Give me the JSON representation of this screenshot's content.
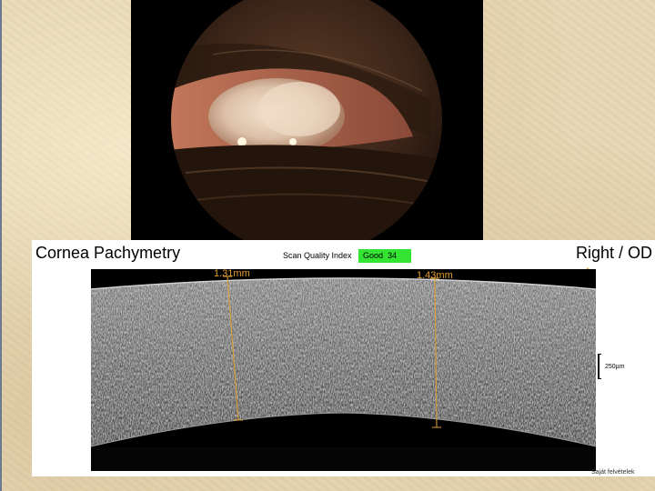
{
  "oct": {
    "title": "Cornea Pachymetry",
    "scan_quality_label": "Scan Quality Index",
    "scan_quality_value": "Good",
    "scan_quality_score": "34",
    "eye": "Right / OD",
    "measure_left": "1.31mm",
    "measure_right": "1.43mm",
    "scale": "250µm"
  },
  "credit": "Saját felvételek",
  "colors": {
    "quality_badge": "#33e433",
    "caliper": "#e0a030",
    "background": "#e6d7b4"
  },
  "icons": {
    "direction": "up-arrow-icon"
  }
}
